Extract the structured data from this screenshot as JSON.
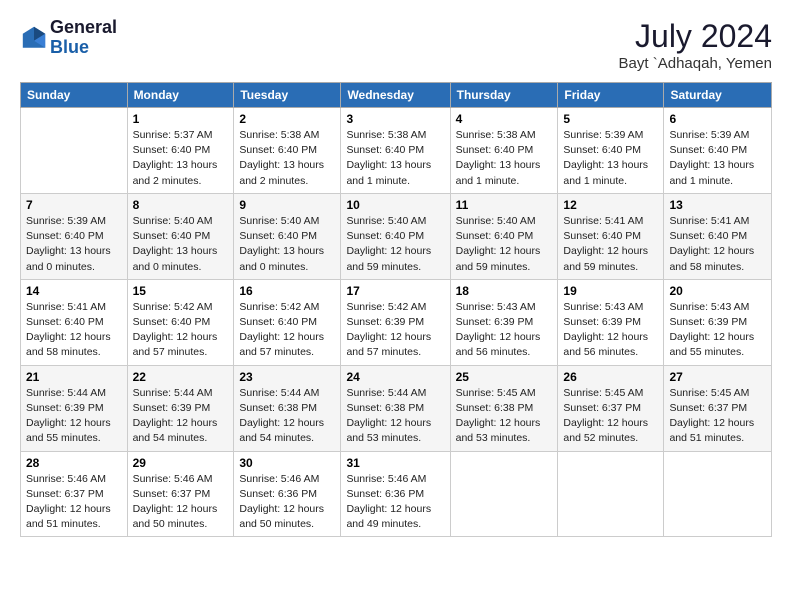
{
  "logo": {
    "general": "General",
    "blue": "Blue"
  },
  "header": {
    "month_year": "July 2024",
    "location": "Bayt `Adhaqah, Yemen"
  },
  "weekdays": [
    "Sunday",
    "Monday",
    "Tuesday",
    "Wednesday",
    "Thursday",
    "Friday",
    "Saturday"
  ],
  "weeks": [
    [
      {
        "day": "",
        "sunrise": "",
        "sunset": "",
        "daylight": ""
      },
      {
        "day": "1",
        "sunrise": "Sunrise: 5:37 AM",
        "sunset": "Sunset: 6:40 PM",
        "daylight": "Daylight: 13 hours and 2 minutes."
      },
      {
        "day": "2",
        "sunrise": "Sunrise: 5:38 AM",
        "sunset": "Sunset: 6:40 PM",
        "daylight": "Daylight: 13 hours and 2 minutes."
      },
      {
        "day": "3",
        "sunrise": "Sunrise: 5:38 AM",
        "sunset": "Sunset: 6:40 PM",
        "daylight": "Daylight: 13 hours and 1 minute."
      },
      {
        "day": "4",
        "sunrise": "Sunrise: 5:38 AM",
        "sunset": "Sunset: 6:40 PM",
        "daylight": "Daylight: 13 hours and 1 minute."
      },
      {
        "day": "5",
        "sunrise": "Sunrise: 5:39 AM",
        "sunset": "Sunset: 6:40 PM",
        "daylight": "Daylight: 13 hours and 1 minute."
      },
      {
        "day": "6",
        "sunrise": "Sunrise: 5:39 AM",
        "sunset": "Sunset: 6:40 PM",
        "daylight": "Daylight: 13 hours and 1 minute."
      }
    ],
    [
      {
        "day": "7",
        "sunrise": "Sunrise: 5:39 AM",
        "sunset": "Sunset: 6:40 PM",
        "daylight": "Daylight: 13 hours and 0 minutes."
      },
      {
        "day": "8",
        "sunrise": "Sunrise: 5:40 AM",
        "sunset": "Sunset: 6:40 PM",
        "daylight": "Daylight: 13 hours and 0 minutes."
      },
      {
        "day": "9",
        "sunrise": "Sunrise: 5:40 AM",
        "sunset": "Sunset: 6:40 PM",
        "daylight": "Daylight: 13 hours and 0 minutes."
      },
      {
        "day": "10",
        "sunrise": "Sunrise: 5:40 AM",
        "sunset": "Sunset: 6:40 PM",
        "daylight": "Daylight: 12 hours and 59 minutes."
      },
      {
        "day": "11",
        "sunrise": "Sunrise: 5:40 AM",
        "sunset": "Sunset: 6:40 PM",
        "daylight": "Daylight: 12 hours and 59 minutes."
      },
      {
        "day": "12",
        "sunrise": "Sunrise: 5:41 AM",
        "sunset": "Sunset: 6:40 PM",
        "daylight": "Daylight: 12 hours and 59 minutes."
      },
      {
        "day": "13",
        "sunrise": "Sunrise: 5:41 AM",
        "sunset": "Sunset: 6:40 PM",
        "daylight": "Daylight: 12 hours and 58 minutes."
      }
    ],
    [
      {
        "day": "14",
        "sunrise": "Sunrise: 5:41 AM",
        "sunset": "Sunset: 6:40 PM",
        "daylight": "Daylight: 12 hours and 58 minutes."
      },
      {
        "day": "15",
        "sunrise": "Sunrise: 5:42 AM",
        "sunset": "Sunset: 6:40 PM",
        "daylight": "Daylight: 12 hours and 57 minutes."
      },
      {
        "day": "16",
        "sunrise": "Sunrise: 5:42 AM",
        "sunset": "Sunset: 6:40 PM",
        "daylight": "Daylight: 12 hours and 57 minutes."
      },
      {
        "day": "17",
        "sunrise": "Sunrise: 5:42 AM",
        "sunset": "Sunset: 6:39 PM",
        "daylight": "Daylight: 12 hours and 57 minutes."
      },
      {
        "day": "18",
        "sunrise": "Sunrise: 5:43 AM",
        "sunset": "Sunset: 6:39 PM",
        "daylight": "Daylight: 12 hours and 56 minutes."
      },
      {
        "day": "19",
        "sunrise": "Sunrise: 5:43 AM",
        "sunset": "Sunset: 6:39 PM",
        "daylight": "Daylight: 12 hours and 56 minutes."
      },
      {
        "day": "20",
        "sunrise": "Sunrise: 5:43 AM",
        "sunset": "Sunset: 6:39 PM",
        "daylight": "Daylight: 12 hours and 55 minutes."
      }
    ],
    [
      {
        "day": "21",
        "sunrise": "Sunrise: 5:44 AM",
        "sunset": "Sunset: 6:39 PM",
        "daylight": "Daylight: 12 hours and 55 minutes."
      },
      {
        "day": "22",
        "sunrise": "Sunrise: 5:44 AM",
        "sunset": "Sunset: 6:39 PM",
        "daylight": "Daylight: 12 hours and 54 minutes."
      },
      {
        "day": "23",
        "sunrise": "Sunrise: 5:44 AM",
        "sunset": "Sunset: 6:38 PM",
        "daylight": "Daylight: 12 hours and 54 minutes."
      },
      {
        "day": "24",
        "sunrise": "Sunrise: 5:44 AM",
        "sunset": "Sunset: 6:38 PM",
        "daylight": "Daylight: 12 hours and 53 minutes."
      },
      {
        "day": "25",
        "sunrise": "Sunrise: 5:45 AM",
        "sunset": "Sunset: 6:38 PM",
        "daylight": "Daylight: 12 hours and 53 minutes."
      },
      {
        "day": "26",
        "sunrise": "Sunrise: 5:45 AM",
        "sunset": "Sunset: 6:37 PM",
        "daylight": "Daylight: 12 hours and 52 minutes."
      },
      {
        "day": "27",
        "sunrise": "Sunrise: 5:45 AM",
        "sunset": "Sunset: 6:37 PM",
        "daylight": "Daylight: 12 hours and 51 minutes."
      }
    ],
    [
      {
        "day": "28",
        "sunrise": "Sunrise: 5:46 AM",
        "sunset": "Sunset: 6:37 PM",
        "daylight": "Daylight: 12 hours and 51 minutes."
      },
      {
        "day": "29",
        "sunrise": "Sunrise: 5:46 AM",
        "sunset": "Sunset: 6:37 PM",
        "daylight": "Daylight: 12 hours and 50 minutes."
      },
      {
        "day": "30",
        "sunrise": "Sunrise: 5:46 AM",
        "sunset": "Sunset: 6:36 PM",
        "daylight": "Daylight: 12 hours and 50 minutes."
      },
      {
        "day": "31",
        "sunrise": "Sunrise: 5:46 AM",
        "sunset": "Sunset: 6:36 PM",
        "daylight": "Daylight: 12 hours and 49 minutes."
      },
      {
        "day": "",
        "sunrise": "",
        "sunset": "",
        "daylight": ""
      },
      {
        "day": "",
        "sunrise": "",
        "sunset": "",
        "daylight": ""
      },
      {
        "day": "",
        "sunrise": "",
        "sunset": "",
        "daylight": ""
      }
    ]
  ]
}
